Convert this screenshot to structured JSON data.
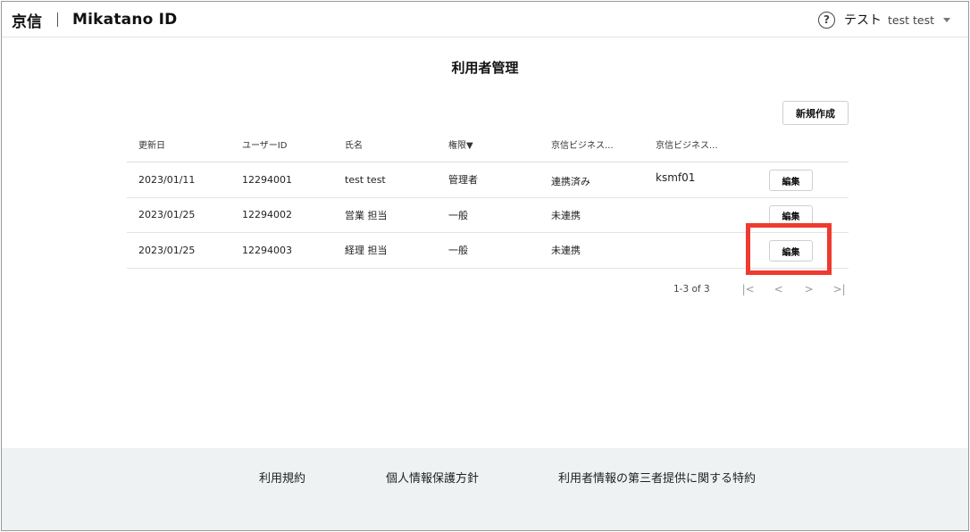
{
  "header": {
    "company": "京信",
    "product": "Mikatano ID",
    "help_icon": "?",
    "user_org": "テスト",
    "user_name": "test test"
  },
  "main": {
    "title": "利用者管理",
    "new_button_label": "新規作成"
  },
  "table": {
    "columns": [
      "更新日",
      "ユーザーID",
      "氏名",
      "権限▼",
      "京信ビジネス...",
      "京信ビジネス..."
    ],
    "rows": [
      {
        "updated": "2023/01/11",
        "user_id": "12294001",
        "name": "test test",
        "role": "管理者",
        "link_status": "連携済み",
        "biz_id": "ksmf01",
        "edit_label": "編集"
      },
      {
        "updated": "2023/01/25",
        "user_id": "12294002",
        "name": "営業 担当",
        "role": "一般",
        "link_status": "未連携",
        "biz_id": "",
        "edit_label": "編集"
      },
      {
        "updated": "2023/01/25",
        "user_id": "12294003",
        "name": "経理 担当",
        "role": "一般",
        "link_status": "未連携",
        "biz_id": "",
        "edit_label": "編集"
      }
    ]
  },
  "pagination": {
    "range_text": "1-3 of 3",
    "first_icon": "|<",
    "prev_icon": "<",
    "next_icon": ">",
    "last_icon": ">|"
  },
  "footer": {
    "terms": "利用規約",
    "privacy": "個人情報保護方針",
    "third_party": "利用者情報の第三者提供に関する特約"
  },
  "colors": {
    "highlight": "#ef3a2f",
    "footer_bg": "#eff2f2"
  }
}
